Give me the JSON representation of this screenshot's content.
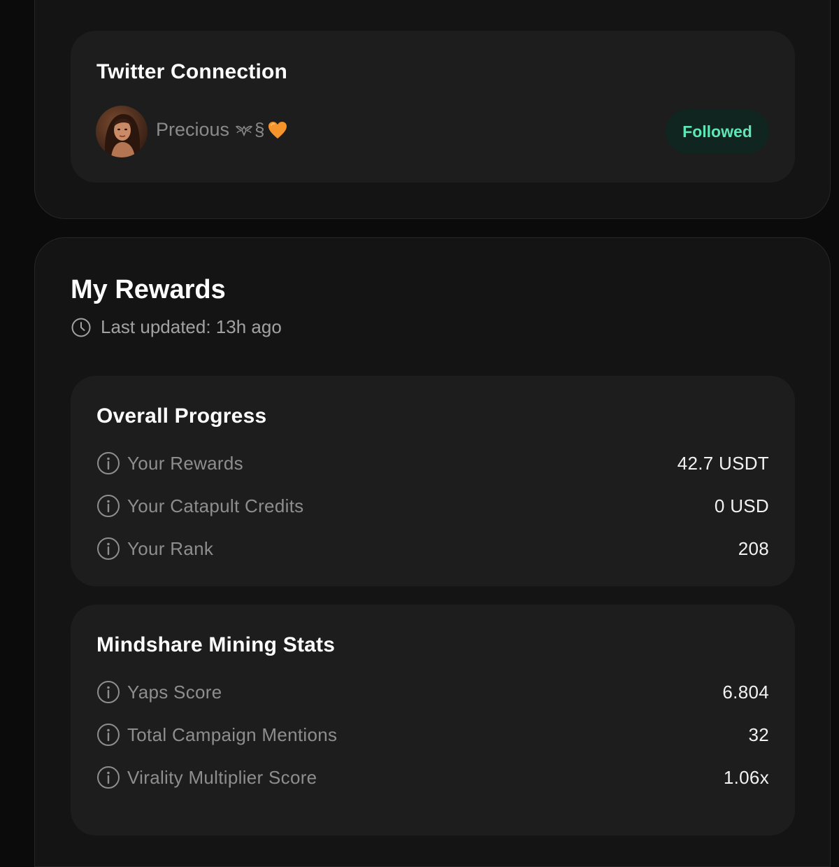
{
  "twitter": {
    "title": "Twitter Connection",
    "user_name": "Precious",
    "user_deco_text": "§",
    "followed_label": "Followed"
  },
  "rewards": {
    "title": "My Rewards",
    "last_updated": "Last updated: 13h ago",
    "overall": {
      "title": "Overall Progress",
      "rows": [
        {
          "label": "Your Rewards",
          "value": "42.7 USDT"
        },
        {
          "label": "Your Catapult Credits",
          "value": "0 USD"
        },
        {
          "label": "Your Rank",
          "value": "208"
        }
      ]
    },
    "mining": {
      "title": "Mindshare Mining Stats",
      "rows": [
        {
          "label": "Yaps Score",
          "value": "6.804"
        },
        {
          "label": "Total Campaign Mentions",
          "value": "32"
        },
        {
          "label": "Virality Multiplier Score",
          "value": "1.06x"
        }
      ]
    }
  },
  "colors": {
    "page_background": "#0b0b0b",
    "outer_card": "#141414",
    "inner_card": "#1d1d1d",
    "followed_text": "#5ee6b4",
    "followed_background": "#10251f",
    "heart": "#f5942a"
  },
  "icons": [
    "avatar-photo",
    "winged-emblem-icon",
    "orange-heart-icon",
    "clock-icon",
    "info-icon"
  ]
}
